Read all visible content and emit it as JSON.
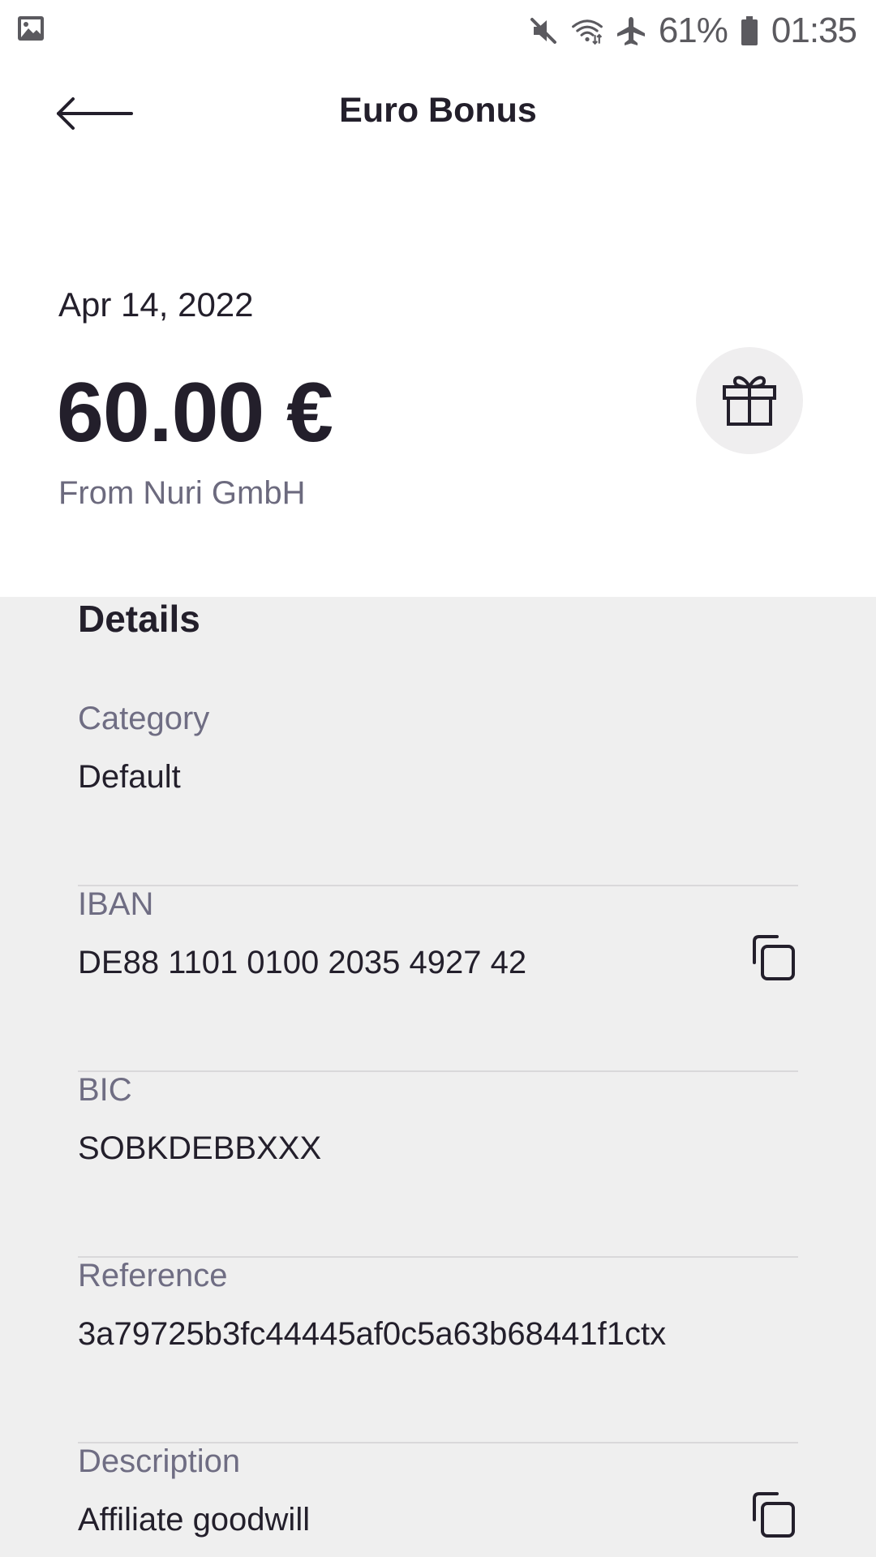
{
  "status_bar": {
    "battery": "61%",
    "time": "01:35",
    "left_icon": "image-icon",
    "icons": [
      "mute-icon",
      "wifi-icon",
      "airplane-icon",
      "battery-icon"
    ]
  },
  "header": {
    "title": "Euro Bonus",
    "back_icon": "arrow-left-icon"
  },
  "summary": {
    "date": "Apr 14, 2022",
    "amount": "60.00 €",
    "from": "From Nuri GmbH",
    "icon": "gift-icon"
  },
  "details": {
    "title": "Details",
    "rows": [
      {
        "label": "Category",
        "value": "Default"
      },
      {
        "label": "IBAN",
        "value": "DE88 1101 0100 2035 4927 42",
        "action_icon": "copy-icon"
      },
      {
        "label": "BIC",
        "value": "SOBKDEBBXXX"
      },
      {
        "label": "Reference",
        "value": "3a79725b3fc44445af0c5a63b68441f1ctx"
      },
      {
        "label": "Description",
        "value": "Affiliate goodwill",
        "action_icon": "copy-icon"
      }
    ]
  },
  "colors": {
    "text_primary": "#231f2b",
    "text_secondary": "#6f6d83",
    "details_background": "#efefef",
    "icon_circle_background": "#efeeef"
  }
}
